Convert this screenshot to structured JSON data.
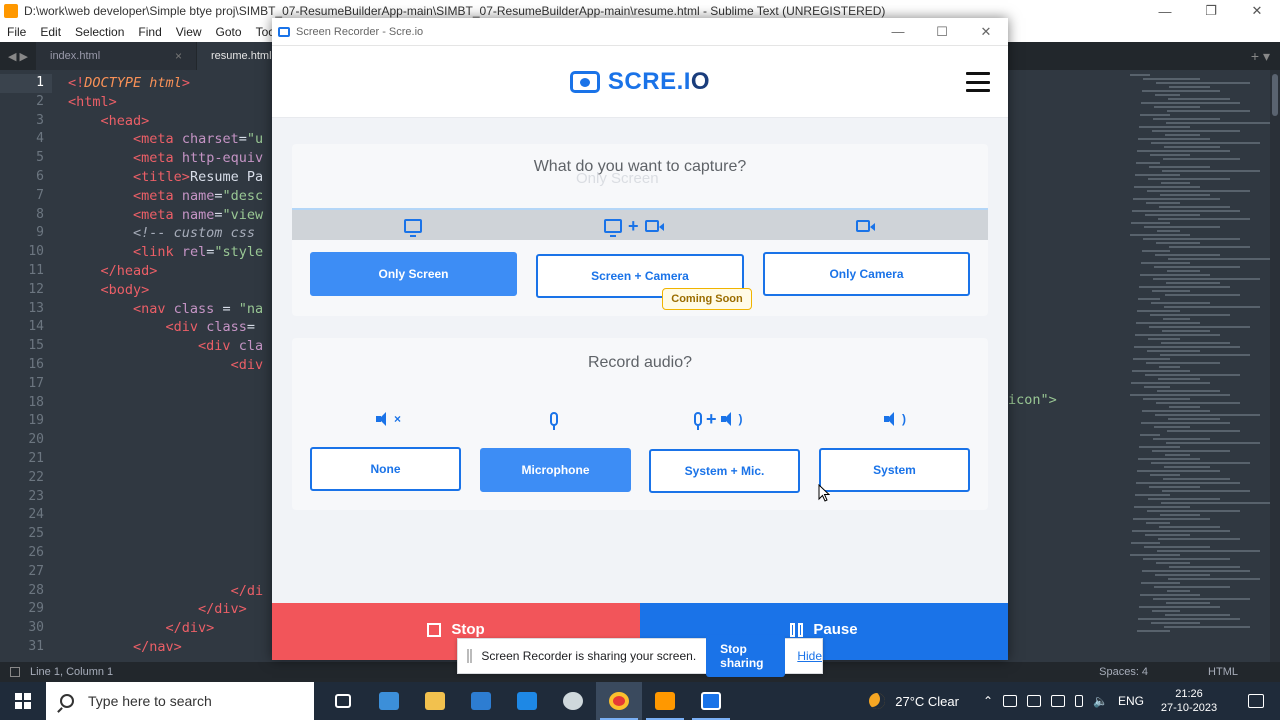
{
  "sublime": {
    "title": "D:\\work\\web developer\\Simple btye proj\\SIMBT_07-ResumeBuilderApp-main\\SIMBT_07-ResumeBuilderApp-main\\resume.html - Sublime Text (UNREGISTERED)",
    "menu": [
      "File",
      "Edit",
      "Selection",
      "Find",
      "View",
      "Goto",
      "Tools"
    ],
    "tabs": [
      {
        "label": "index.html"
      },
      {
        "label": "resume.html"
      }
    ],
    "line_numbers": [
      "1",
      "2",
      "3",
      "4",
      "5",
      "6",
      "7",
      "8",
      "9",
      "10",
      "11",
      "12",
      "13",
      "14",
      "15",
      "16",
      "17",
      "18",
      "19",
      "20",
      "21",
      "22",
      "23",
      "24",
      "25",
      "26",
      "27",
      "28",
      "29",
      "30",
      "31"
    ],
    "code_right_fragment": "icon\">",
    "status_left": "Line 1, Column 1",
    "status_spaces": "Spaces: 4",
    "status_syntax": "HTML"
  },
  "recorder": {
    "window_title": "Screen Recorder - Scre.io",
    "logo_text": "SCRE.I",
    "logo_text_o": "O",
    "capture_title": "What do you want to capture?",
    "ghost_text": "Only Screen",
    "capture_options": [
      "Only Screen",
      "Screen + Camera",
      "Only Camera"
    ],
    "capture_selected": "Only Screen",
    "coming_soon": "Coming Soon",
    "audio_title": "Record audio?",
    "audio_options": [
      "None",
      "Microphone",
      "System + Mic.",
      "System"
    ],
    "audio_selected": "Microphone",
    "stop_label": "Stop",
    "pause_label": "Pause",
    "accent_color": "#1a73e8",
    "stop_color": "#f2555a"
  },
  "share_notice": {
    "text": "Screen Recorder is sharing your screen.",
    "stop_label": "Stop sharing",
    "hide_label": "Hide"
  },
  "taskbar": {
    "search_placeholder": "Type here to search",
    "weather": "27°C  Clear",
    "language": "ENG",
    "time": "21:26",
    "date": "27-10-2023",
    "apps": [
      "task-view-icon",
      "file-explorer-icon",
      "folder-icon",
      "store-icon",
      "mail-icon",
      "settings-icon",
      "chrome-icon",
      "sublime-text-icon",
      "screen-recorder-icon"
    ]
  }
}
